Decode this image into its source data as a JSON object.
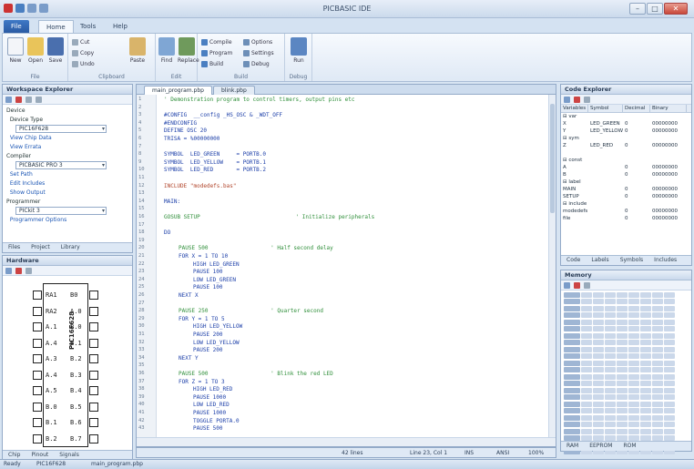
{
  "window": {
    "title": "PICBASIC IDE",
    "controls": {
      "minimize": "–",
      "maximize": "□",
      "close": "✕"
    }
  },
  "ribbon": {
    "tabs": [
      "File",
      "Home",
      "Tools",
      "Help"
    ],
    "groups": [
      {
        "label": "File",
        "buttons": [
          "New",
          "Open",
          "Save"
        ]
      },
      {
        "label": "Clipboard",
        "buttons": [
          "Paste",
          "Cut",
          "Copy",
          "Undo"
        ]
      },
      {
        "label": "Edit",
        "buttons": [
          "Find",
          "Replace"
        ]
      },
      {
        "label": "Build",
        "buttons": [
          "Compile",
          "Program",
          "Build",
          "Options",
          "Settings",
          "Debug"
        ]
      },
      {
        "label": "Debug",
        "buttons": [
          "Run"
        ]
      }
    ]
  },
  "workspace": {
    "title": "Workspace Explorer",
    "items": [
      {
        "kind": "grp",
        "text": "Device"
      },
      {
        "kind": "grp",
        "text": "  Device Type"
      },
      {
        "kind": "combo",
        "text": "PIC16F628"
      },
      {
        "kind": "link",
        "text": "  View Chip Data"
      },
      {
        "kind": "link",
        "text": "  View Errata"
      },
      {
        "kind": "grp",
        "text": "Compiler"
      },
      {
        "kind": "combo",
        "text": "PICBASIC PRO 3"
      },
      {
        "kind": "link",
        "text": "  Set Path"
      },
      {
        "kind": "link",
        "text": "  Edit Includes"
      },
      {
        "kind": "link",
        "text": "  Show Output"
      },
      {
        "kind": "grp",
        "text": "Programmer"
      },
      {
        "kind": "combo",
        "text": "PICkit 3"
      },
      {
        "kind": "link",
        "text": "  Programmer Options"
      }
    ],
    "tabs": [
      "Files",
      "Project",
      "Library"
    ]
  },
  "hardware": {
    "title": "Hardware",
    "chip_name": "PIC16F628",
    "left_pins": [
      "RA1",
      "RA2",
      "A.1",
      "A.4",
      "A.3",
      "A.4",
      "A.5",
      "B.0",
      "B.1",
      "B.2"
    ],
    "right_pins": [
      "B0",
      "A.0",
      "B.0",
      "B.1",
      "B.2",
      "B.3",
      "B.4",
      "B.5",
      "B.6",
      "B.7"
    ],
    "tabs": [
      "Chip",
      "Pinout",
      "Signals"
    ]
  },
  "editor": {
    "tabs": [
      "main_program.pbp",
      "blink.pbp"
    ],
    "lines": [
      {
        "indent": 0,
        "text": "' Demonstration program to control timers, output pins etc",
        "cls": "cm"
      },
      {
        "indent": 0,
        "text": ""
      },
      {
        "indent": 0,
        "text": "#CONFIG  __config _HS_OSC & _WDT_OFF"
      },
      {
        "indent": 0,
        "text": "#ENDCONFIG"
      },
      {
        "indent": 0,
        "text": "DEFINE OSC 20"
      },
      {
        "indent": 0,
        "text": "TRISA = %00000000"
      },
      {
        "indent": 0,
        "text": ""
      },
      {
        "indent": 0,
        "text": "SYMBOL  LED_GREEN     = PORTB.0"
      },
      {
        "indent": 0,
        "text": "SYMBOL  LED_YELLOW    = PORTB.1"
      },
      {
        "indent": 0,
        "text": "SYMBOL  LED_RED       = PORTB.2"
      },
      {
        "indent": 0,
        "text": ""
      },
      {
        "indent": 0,
        "text": "INCLUDE \"modedefs.bas\"",
        "cls": "str"
      },
      {
        "indent": 0,
        "text": ""
      },
      {
        "indent": 0,
        "text": "MAIN:"
      },
      {
        "indent": 0,
        "text": ""
      },
      {
        "indent": 0,
        "text": "GOSUB SETUP                             ' Initialize peripherals",
        "cls": "cm"
      },
      {
        "indent": 0,
        "text": ""
      },
      {
        "indent": 0,
        "text": "DO"
      },
      {
        "indent": 0,
        "text": ""
      },
      {
        "indent": 4,
        "text": "PAUSE 500                   ' Half second delay",
        "cls": "cm"
      },
      {
        "indent": 4,
        "text": "FOR X = 1 TO 10"
      },
      {
        "indent": 8,
        "text": "HIGH LED_GREEN"
      },
      {
        "indent": 8,
        "text": "PAUSE 100"
      },
      {
        "indent": 8,
        "text": "LOW LED_GREEN"
      },
      {
        "indent": 8,
        "text": "PAUSE 100"
      },
      {
        "indent": 4,
        "text": "NEXT X"
      },
      {
        "indent": 0,
        "text": ""
      },
      {
        "indent": 4,
        "text": "PAUSE 250                   ' Quarter second",
        "cls": "cm"
      },
      {
        "indent": 4,
        "text": "FOR Y = 1 TO 5"
      },
      {
        "indent": 8,
        "text": "HIGH LED_YELLOW"
      },
      {
        "indent": 8,
        "text": "PAUSE 200"
      },
      {
        "indent": 8,
        "text": "LOW LED_YELLOW"
      },
      {
        "indent": 8,
        "text": "PAUSE 200"
      },
      {
        "indent": 4,
        "text": "NEXT Y"
      },
      {
        "indent": 0,
        "text": ""
      },
      {
        "indent": 4,
        "text": "PAUSE 500                   ' Blink the red LED",
        "cls": "cm"
      },
      {
        "indent": 4,
        "text": "FOR Z = 1 TO 3"
      },
      {
        "indent": 8,
        "text": "HIGH LED_RED"
      },
      {
        "indent": 8,
        "text": "PAUSE 1000"
      },
      {
        "indent": 8,
        "text": "LOW LED_RED"
      },
      {
        "indent": 8,
        "text": "PAUSE 1000"
      },
      {
        "indent": 8,
        "text": "TOGGLE PORTA.0"
      },
      {
        "indent": 8,
        "text": "PAUSE 500"
      }
    ],
    "status": {
      "mode": "INS",
      "position": "Line 23, Col 1",
      "lines": "42 lines",
      "encoding": "ANSI",
      "zoom": "100%"
    }
  },
  "code_explorer": {
    "title": "Code Explorer",
    "columns": [
      "Variables",
      "Symbol",
      "Decimal",
      "Binary"
    ],
    "rows": [
      [
        "⊟ var",
        "",
        "",
        ""
      ],
      [
        "   X",
        "LED_GREEN",
        "0",
        "00000000"
      ],
      [
        "   Y",
        "LED_YELLOW",
        "0",
        "00000000"
      ],
      [
        "⊟ sym",
        "",
        "",
        ""
      ],
      [
        "   Z",
        "LED_RED",
        "0",
        "00000000"
      ],
      [
        "",
        "",
        "",
        ""
      ],
      [
        "⊟ const",
        "",
        "",
        ""
      ],
      [
        "   A",
        "",
        "0",
        "00000000"
      ],
      [
        "   B",
        "",
        "0",
        "00000000"
      ],
      [
        "⊟ label",
        "",
        "",
        ""
      ],
      [
        "   MAIN",
        "",
        "0",
        "00000000"
      ],
      [
        "   SETUP",
        "",
        "0",
        "00000000"
      ],
      [
        "⊟ include",
        "",
        "",
        ""
      ],
      [
        "   modedefs",
        "",
        "0",
        "00000000"
      ],
      [
        "   file",
        "",
        "0",
        "00000000"
      ]
    ],
    "tabs": [
      "Code",
      "Labels",
      "Symbols",
      "Includes"
    ]
  },
  "memory": {
    "title": "Memory",
    "rows": 24,
    "cols": 8,
    "tabs": [
      "RAM",
      "EEPROM",
      "ROM"
    ]
  },
  "statusbar": {
    "ready": "Ready",
    "device": "PIC16F628",
    "project": "main_program.pbp"
  },
  "colors": {
    "accent": "#2a5aa3",
    "panel_border": "#93aac8",
    "keyword": "#1b3ea8",
    "comment": "#2f8f3a",
    "string": "#b1452b"
  }
}
